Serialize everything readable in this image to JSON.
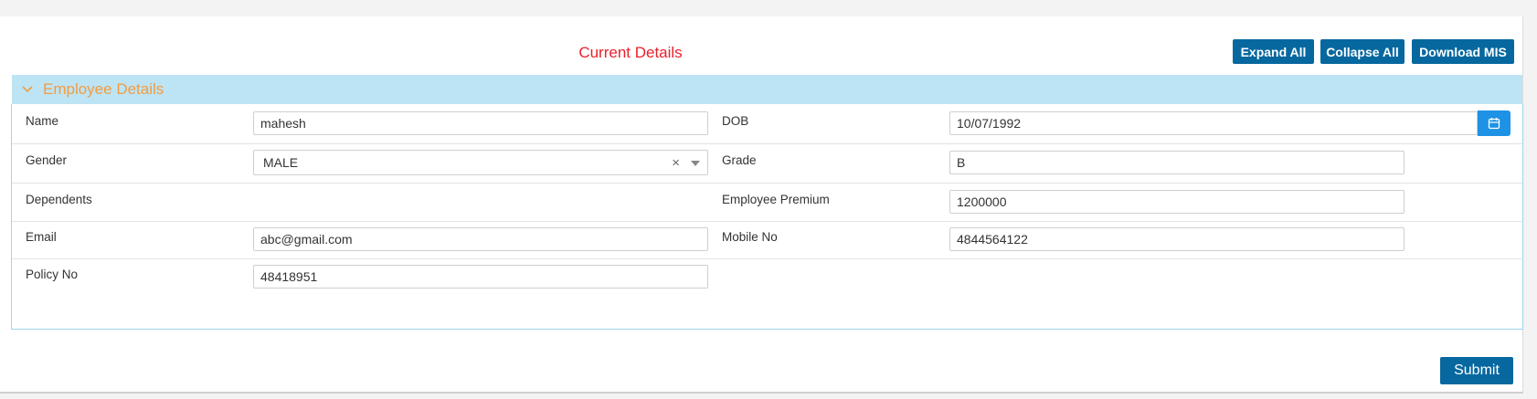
{
  "header": {
    "title": "Current Details",
    "expand_all": "Expand All",
    "collapse_all": "Collapse All",
    "download_mis": "Download MIS"
  },
  "accordion": {
    "title": "Employee Details",
    "expanded": true
  },
  "fields": {
    "name": {
      "label": "Name",
      "value": "mahesh"
    },
    "dob": {
      "label": "DOB",
      "value": "10/07/1992"
    },
    "gender": {
      "label": "Gender",
      "value": "MALE"
    },
    "grade": {
      "label": "Grade",
      "value": "B"
    },
    "dependents": {
      "label": "Dependents"
    },
    "employee_premium": {
      "label": "Employee Premium",
      "value": "1200000"
    },
    "email": {
      "label": "Email",
      "value": "abc@gmail.com"
    },
    "mobile_no": {
      "label": "Mobile No",
      "value": "4844564122"
    },
    "policy_no": {
      "label": "Policy No",
      "value": "48418951"
    }
  },
  "footer": {
    "submit": "Submit"
  },
  "colors": {
    "primary_button": "#07689f",
    "title_red": "#e8202a",
    "accordion_bg": "#bde4f4",
    "accordion_title": "#f39c42",
    "calendar_button": "#1e93e6"
  },
  "icons": {
    "accordion_toggle": "chevron-down-icon",
    "date_picker": "calendar-icon",
    "select_clear": "clear-icon",
    "select_open": "caret-down-icon"
  }
}
